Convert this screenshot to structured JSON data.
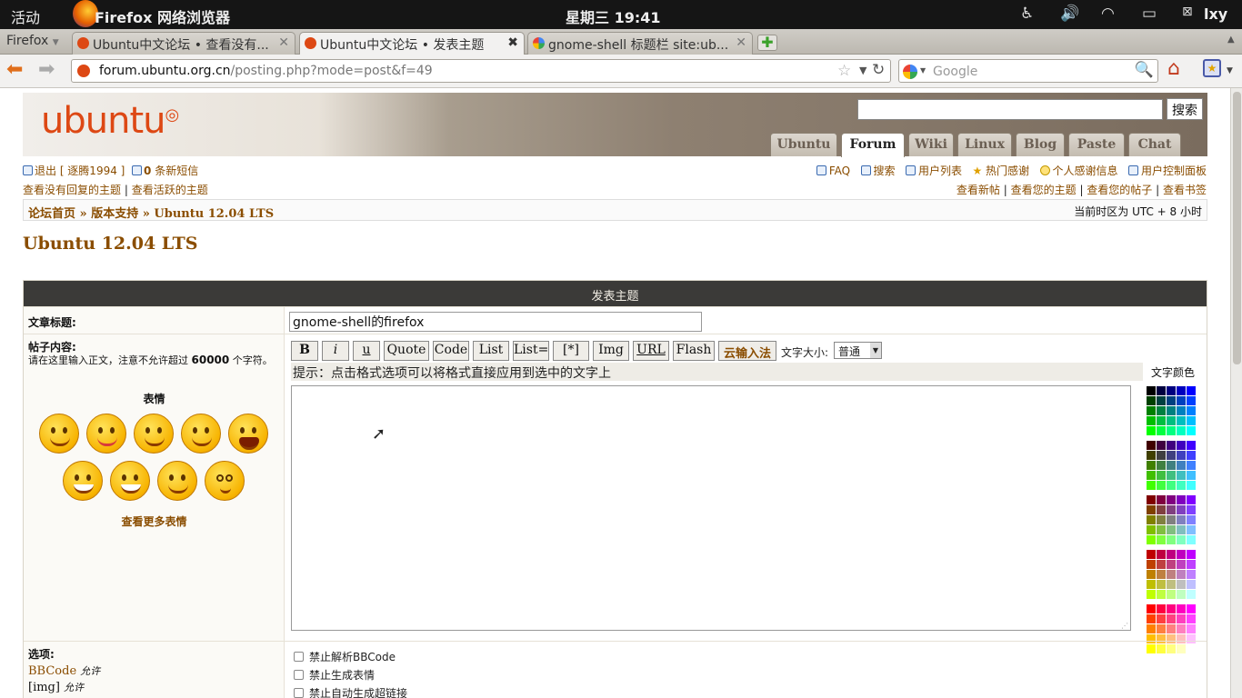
{
  "topbar": {
    "activities": "活动",
    "app": "Firefox 网络浏览器",
    "clock": "星期三 19:41",
    "user": "lxy"
  },
  "browser": {
    "menu": "Firefox",
    "tabs": [
      {
        "label": "Ubuntu中文论坛 • 查看没有..."
      },
      {
        "label": "Ubuntu中文论坛 • 发表主题"
      },
      {
        "label": "gnome-shell 标题栏 site:ub..."
      }
    ],
    "url_domain": "forum.ubuntu.org.cn",
    "url_path": "/posting.php?mode=post&f=49",
    "search_placeholder": "Google"
  },
  "site": {
    "logo": "ubuntu",
    "search_btn": "搜索",
    "nav": [
      "Ubuntu",
      "Forum",
      "Wiki",
      "Linux",
      "Blog",
      "Paste",
      "Chat"
    ],
    "selected_nav": "Forum"
  },
  "user": {
    "logout": "退出 [ 逐腾1994 ]",
    "pm_count": "0",
    "pm_text": "条新短信",
    "link_unanswered": "查看没有回复的主题",
    "link_active": "查看活跃的主题",
    "right_top": [
      "FAQ",
      "搜索",
      "用户列表",
      "热门感谢",
      "个人感谢信息",
      "用户控制面板"
    ],
    "right_bottom": [
      "查看新帖",
      "查看您的主题",
      "查看您的帖子",
      "查看书签"
    ]
  },
  "breadcrumb": {
    "home": "论坛首页",
    "sep": "»",
    "l2": "版本支持",
    "l3": "Ubuntu 12.04 LTS",
    "timezone": "当前时区为 UTC + 8 小时"
  },
  "forum_title": "Ubuntu 12.04 LTS",
  "form": {
    "header": "发表主题",
    "subject_label": "文章标题:",
    "subject_value": "gnome-shell的firefox",
    "body_label": "帖子内容:",
    "body_note": "请在这里输入正文，注意不允许超过",
    "body_limit": "60000",
    "body_unit": "个字符。",
    "smilies_label": "表情",
    "more_smilies": "查看更多表情",
    "bbcode": [
      "B",
      "i",
      "u",
      "Quote",
      "Code",
      "List",
      "List=",
      "[*]",
      "Img",
      "URL",
      "Flash",
      "云输入法"
    ],
    "fontsize_label": "文字大小:",
    "fontsize_value": "普通",
    "hint": "提示：点击格式选项可以将格式直接应用到选中的文字上",
    "color_label": "文字颜色",
    "options_label": "选项:",
    "opt_bbcode": "BBCode",
    "opt_allowed": "允许",
    "opt_img": "[img]",
    "checkboxes": [
      "禁止解析BBCode",
      "禁止生成表情",
      "禁止自动生成超链接"
    ]
  },
  "colors": {
    "accent": "#dd4814",
    "link": "#8a4d00",
    "header_dark": "#3b3a38"
  }
}
